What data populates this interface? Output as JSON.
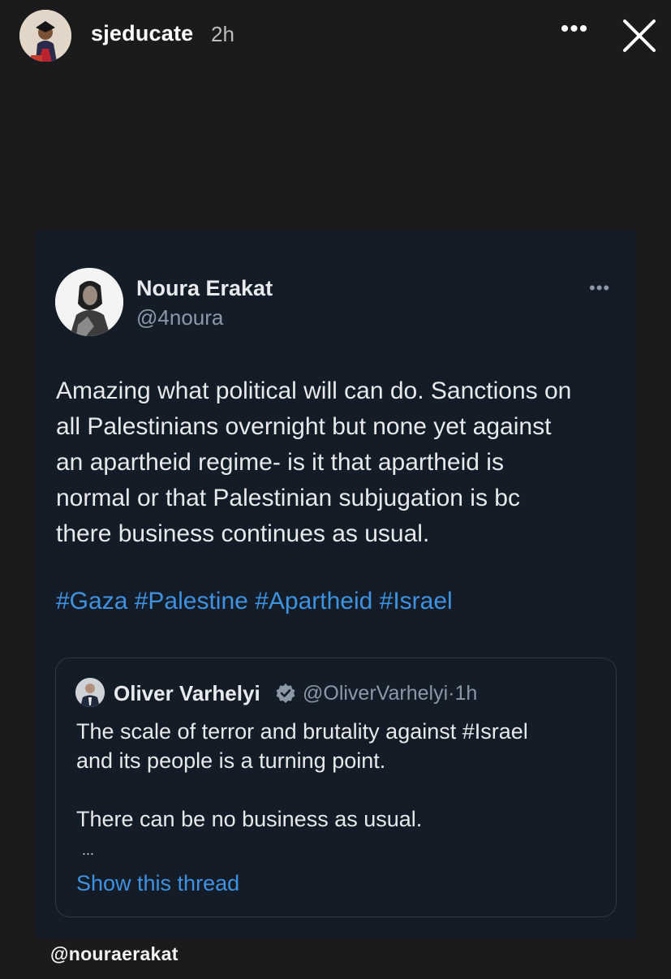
{
  "story": {
    "username": "sjeducate",
    "time": "2h",
    "more_label": "•••",
    "mention": "@nouraerakat"
  },
  "tweet": {
    "author_name": "Noura Erakat",
    "author_handle": "@4noura",
    "more_label": "•••",
    "text_lines": [
      "Amazing what political will can do. Sanctions on",
      "all Palestinians overnight but none yet against",
      "an apartheid regime- is it that apartheid is",
      "normal or that Palestinian subjugation is bc",
      "there business continues as usual."
    ],
    "hashtags": [
      "#Gaza",
      "#Palestine",
      "#Apartheid",
      "#Israel"
    ]
  },
  "quoted_tweet": {
    "author_name": "Oliver Varhelyi",
    "author_handle": "@OliverVarhelyi",
    "separator": "·",
    "time": "1h",
    "text_lines": [
      "The scale of terror and brutality against #Israel",
      "and its people is a turning point.",
      "",
      "There can be no business as usual."
    ],
    "ellipsis": "...",
    "show_thread_label": "Show this thread"
  },
  "colors": {
    "background": "#1b1b1d",
    "card": "#141c28",
    "link": "#3f92e0",
    "secondary_text": "#8b98a5",
    "verified_badge": "#8b98a5"
  },
  "icons": {
    "close": "close-icon",
    "more": "ellipsis-icon",
    "verified": "verified-badge-icon"
  }
}
